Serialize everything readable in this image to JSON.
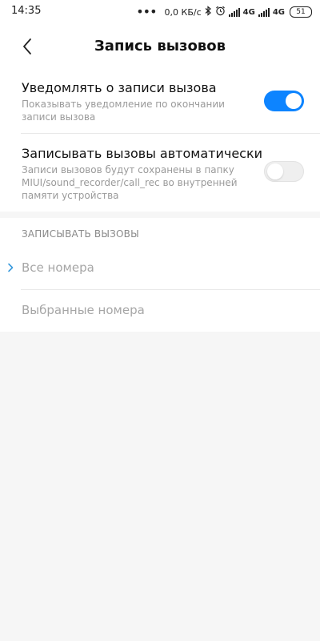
{
  "status_bar": {
    "time": "14:35",
    "dots": "•••",
    "speed": "0,0 КБ/с",
    "network_1": "4G",
    "network_2": "4G",
    "battery": "51",
    "icons": [
      "bluetooth-icon",
      "alarm-icon",
      "signal-icon",
      "signal-icon",
      "battery-icon"
    ]
  },
  "header": {
    "title": "Запись вызовов",
    "back_icon": "chevron-left-icon"
  },
  "settings": [
    {
      "title": "Уведомлять о записи вызова",
      "description": "Показывать уведомление по окончании записи вызова",
      "enabled": true
    },
    {
      "title": "Записывать вызовы автоматически",
      "description": "Записи вызовов будут сохранены в папку MIUI/sound_recorder/call_rec во внутренней памяти устройства",
      "enabled": false
    }
  ],
  "record_section": {
    "header": "ЗАПИСЫВАТЬ ВЫЗОВЫ",
    "options": [
      {
        "label": "Все номера",
        "selected": true
      },
      {
        "label": "Выбранные номера",
        "selected": false
      }
    ]
  },
  "colors": {
    "accent": "#0d84ff",
    "background": "#f6f6f6",
    "title_text": "#111111",
    "secondary_text": "#9a9a9a",
    "chevron": "#3a9bdc"
  }
}
